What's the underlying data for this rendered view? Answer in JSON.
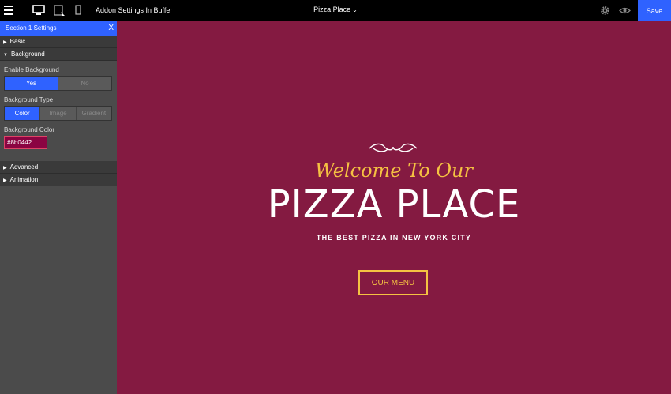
{
  "topbar": {
    "addon_title": "Addon Settings In Buffer",
    "page_name": "Pizza Place",
    "save_label": "Save"
  },
  "panel": {
    "title": "Section 1 Settings",
    "close": "X",
    "sections": {
      "basic": "Basic",
      "background": "Background",
      "advanced": "Advanced",
      "animation": "Animation"
    },
    "enable_bg": {
      "label": "Enable Background",
      "options": [
        "Yes",
        "No"
      ],
      "selected": "Yes"
    },
    "bg_type": {
      "label": "Background Type",
      "options": [
        "Color",
        "Image",
        "Gradient"
      ],
      "selected": "Color"
    },
    "bg_color": {
      "label": "Background Color",
      "value": "#8b0442"
    }
  },
  "hero": {
    "welcome": "Welcome To Our",
    "title": "PIZZA PLACE",
    "subtitle": "THE BEST PIZZA IN NEW YORK CITY",
    "button": "OUR MENU"
  },
  "colors": {
    "accent": "#2f62ff",
    "stage_bg": "#841a41",
    "gold": "#f5c242"
  }
}
